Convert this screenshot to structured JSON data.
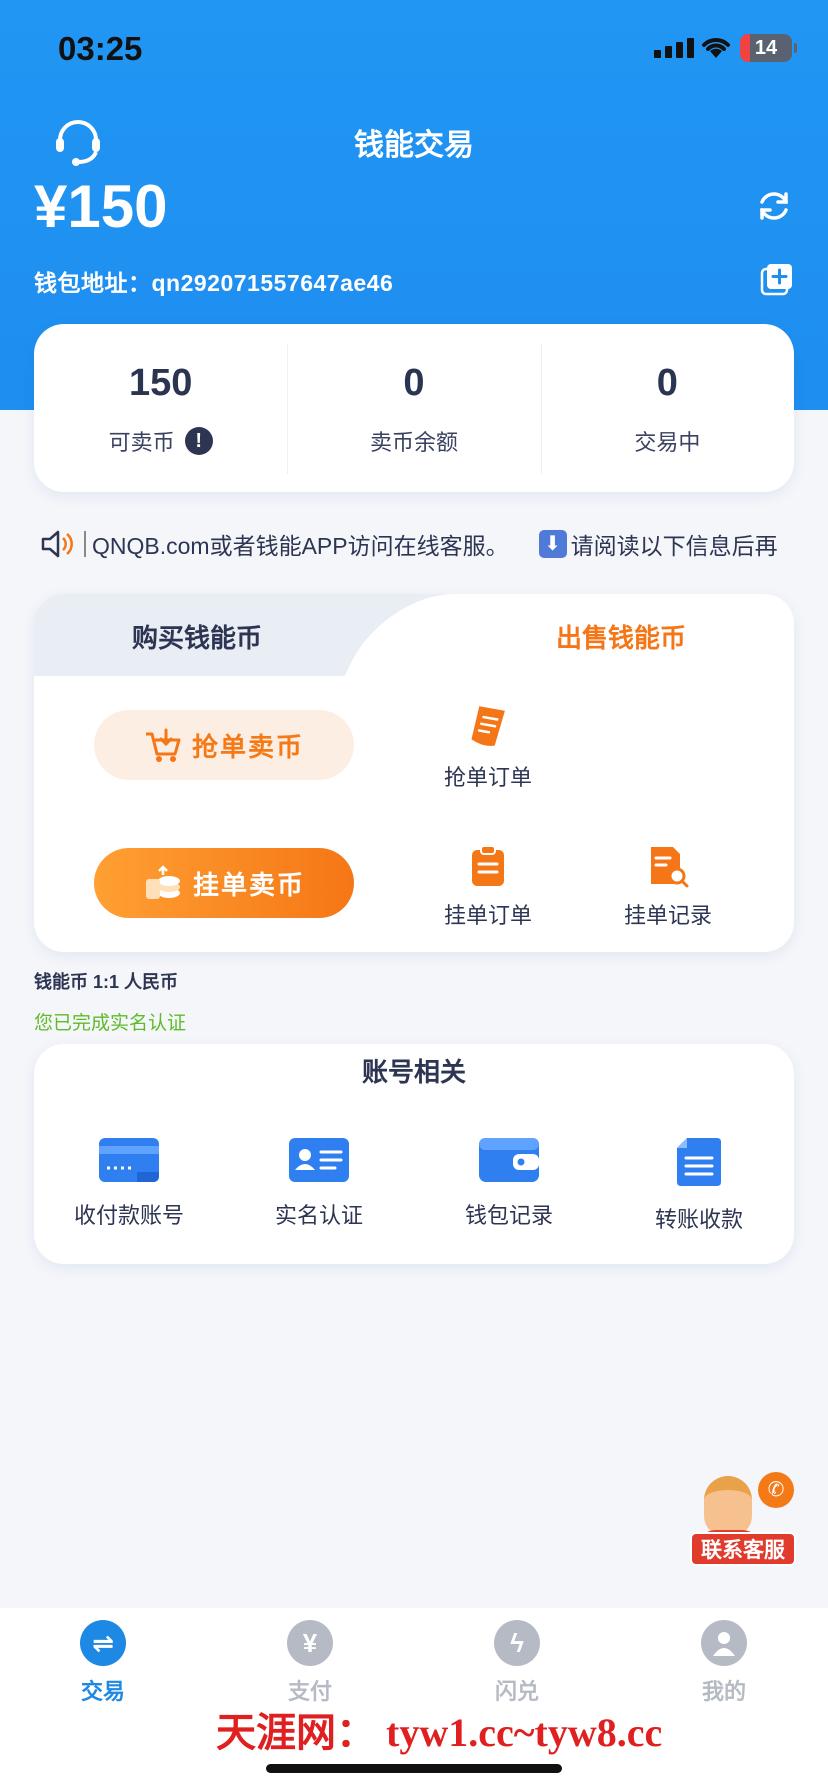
{
  "status_bar": {
    "time": "03:25",
    "battery": "14"
  },
  "header": {
    "title": "钱能交易",
    "balance": "¥150",
    "wallet_address_label": "钱包地址：",
    "wallet_address": "qn292071557647ae46"
  },
  "stats": [
    {
      "value": "150",
      "label": "可卖币"
    },
    {
      "value": "0",
      "label": "卖币余额"
    },
    {
      "value": "0",
      "label": "交易中"
    }
  ],
  "notice": {
    "text1": "QNQB.com或者钱能APP访问在线客服。",
    "text2": "请阅读以下信息后再"
  },
  "trade": {
    "tab_buy": "购买钱能币",
    "tab_sell": "出售钱能币",
    "grab_sell_button": "抢单卖币",
    "list_sell_button": "挂单卖币",
    "grab_orders": "抢单订单",
    "list_orders": "挂单订单",
    "list_records": "挂单记录"
  },
  "rate_note": "钱能币 1:1 人民币",
  "verified_note": "您已完成实名认证",
  "account": {
    "title": "账号相关",
    "items": [
      "收付款账号",
      "实名认证",
      "钱包记录",
      "转账收款"
    ]
  },
  "support_label": "联系客服",
  "tabbar": {
    "items": [
      "交易",
      "支付",
      "闪兑",
      "我的"
    ],
    "active_color": "#1e88e5",
    "inactive_color": "#b5bac4"
  },
  "watermark": "天涯网： tyw1.cc~tyw8.cc",
  "colors": {
    "primary": "#1e8ef0",
    "accent": "#f57616",
    "verified": "#5fbb2a"
  }
}
